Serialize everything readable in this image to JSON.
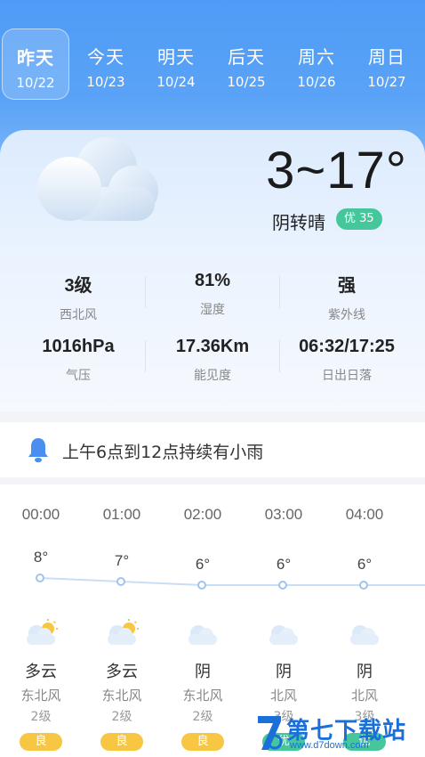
{
  "tabs": [
    {
      "day": "昨天",
      "date": "10/22",
      "active": true
    },
    {
      "day": "今天",
      "date": "10/23",
      "active": false
    },
    {
      "day": "明天",
      "date": "10/24",
      "active": false
    },
    {
      "day": "后天",
      "date": "10/25",
      "active": false
    },
    {
      "day": "周六",
      "date": "10/26",
      "active": false
    },
    {
      "day": "周日",
      "date": "10/27",
      "active": false
    }
  ],
  "current": {
    "temp": "3~17°",
    "condition": "阴转晴",
    "aqi": "优 35",
    "icon": "cloud-icon"
  },
  "stats": [
    {
      "value": "3级",
      "label": "西北风"
    },
    {
      "value": "81%",
      "label": "湿度"
    },
    {
      "value": "强",
      "label": "紫外线"
    },
    {
      "value": "1016hPa",
      "label": "气压"
    },
    {
      "value": "17.36Km",
      "label": "能见度"
    },
    {
      "value": "06:32/17:25",
      "label": "日出日落"
    }
  ],
  "alert": {
    "text": "上午6点到12点持续有小雨",
    "icon": "bell-icon"
  },
  "hourly": [
    {
      "time": "00:00",
      "temp": "8°",
      "temp_value": 8,
      "condition": "多云",
      "wind_dir": "东北风",
      "wind_level": "2级",
      "aqi": "良",
      "icon": "partly-cloudy-icon"
    },
    {
      "time": "01:00",
      "temp": "7°",
      "temp_value": 7,
      "condition": "多云",
      "wind_dir": "东北风",
      "wind_level": "2级",
      "aqi": "良",
      "icon": "partly-cloudy-icon"
    },
    {
      "time": "02:00",
      "temp": "6°",
      "temp_value": 6,
      "condition": "阴",
      "wind_dir": "东北风",
      "wind_level": "2级",
      "aqi": "良",
      "icon": "cloud-icon"
    },
    {
      "time": "03:00",
      "temp": "6°",
      "temp_value": 6,
      "condition": "阴",
      "wind_dir": "北风",
      "wind_level": "3级",
      "aqi": "优",
      "icon": "cloud-icon"
    },
    {
      "time": "04:00",
      "temp": "6°",
      "temp_value": 6,
      "condition": "阴",
      "wind_dir": "北风",
      "wind_level": "3级",
      "aqi": "优",
      "icon": "cloud-icon"
    }
  ],
  "watermark": {
    "text": "第七下载站",
    "url": "www.d7down.com"
  },
  "colors": {
    "header": "#4f9bf6",
    "aqi_good": "#f7c744",
    "aqi_excellent": "#45c79b"
  }
}
